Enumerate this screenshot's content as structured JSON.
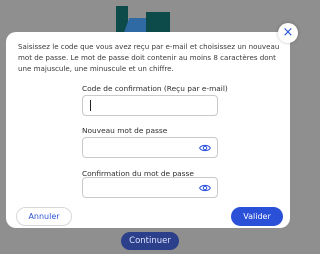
{
  "modal": {
    "intro": "Saisissez le code que vous avez reçu par e-mail et choisissez un nouveau mot de passe. Le mot de passe doit contenir au moins 8 caractères dont une majuscule, une minuscule et un chiffre.",
    "fields": [
      {
        "label": "Code de confirmation (Reçu par e-mail)",
        "value": "",
        "placeholder": ""
      },
      {
        "label": "Nouveau mot de passe",
        "value": "",
        "placeholder": ""
      },
      {
        "label": "Confirmation du mot de passe",
        "value": "",
        "placeholder": ""
      }
    ],
    "cancel_label": "Annuler",
    "validate_label": "Valider",
    "close_icon": "close-icon"
  },
  "background": {
    "continue_label": "Continuer"
  },
  "colors": {
    "accent": "#2b50d8",
    "overlay": "#8f8f8f"
  }
}
